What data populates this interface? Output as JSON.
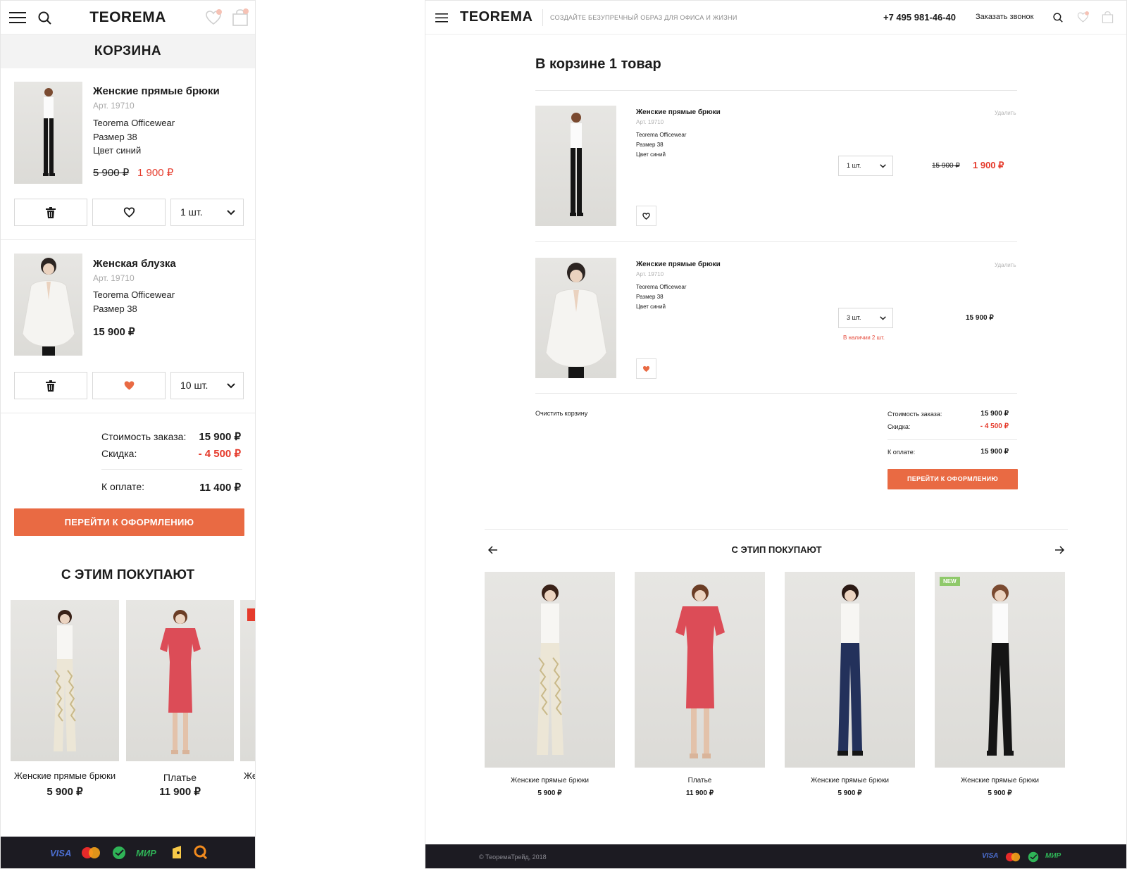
{
  "mobile": {
    "header": {
      "logo": "TEOREMA"
    },
    "title": "КОРЗИНА",
    "items": [
      {
        "name": "Женские прямые брюки",
        "art": "Арт. 19710",
        "brand": "Teorema Officewear",
        "size": "Размер 38",
        "color": "Цвет синий",
        "old_price": "5 900 ₽",
        "price": "1 900 ₽",
        "qty": "1 шт."
      },
      {
        "name": "Женская блузка",
        "art": "Арт. 19710",
        "brand": "Teorema Officewear",
        "size": "Размер 38",
        "price": "15 900 ₽",
        "qty": "10 шт."
      }
    ],
    "summary": {
      "cost_label": "Стоимость заказа:",
      "cost_value": "15 900 ₽",
      "discount_label": "Скидка:",
      "discount_value": "- 4 500 ₽",
      "total_label": "К оплате:",
      "total_value": "11 400 ₽"
    },
    "checkout_label": "ПЕРЕЙТИ К ОФОРМЛЕНИЮ",
    "reco_title": "С ЭТИМ ПОКУПАЮТ",
    "reco": [
      {
        "name": "Женские прямые брюки",
        "price": "5 900 ₽"
      },
      {
        "name": "Платье",
        "price": "11 900 ₽"
      },
      {
        "name": "Же",
        "price": ""
      }
    ],
    "payments": [
      "VISA",
      "МИР"
    ]
  },
  "desktop": {
    "header": {
      "logo": "TEOREMA",
      "tagline": "СОЗДАЙТЕ БЕЗУПРЕЧНЫЙ ОБРАЗ ДЛЯ ОФИСА И ЖИЗНИ",
      "phone": "+7 495 981-46-40",
      "call": "Заказать звонок"
    },
    "title": "В корзине 1 товар",
    "items": [
      {
        "name": "Женские прямые брюки",
        "art": "Арт. 19710",
        "brand": "Teorema Officewear",
        "size": "Размер 38",
        "color": "Цвет синий",
        "remove": "Удалить",
        "qty": "1 шт.",
        "old_price": "15 900 ₽",
        "price": "1 900 ₽"
      },
      {
        "name": "Женские прямые брюки",
        "art": "Арт. 19710",
        "brand": "Teorema Officewear",
        "size": "Размер 38",
        "color": "Цвет синий",
        "remove": "Удалить",
        "qty": "3 шт.",
        "price": "15 900 ₽",
        "stock": "В наличии 2 шт."
      }
    ],
    "clear": "Очистить корзину",
    "summary": {
      "cost_label": "Стоимость заказа:",
      "cost_value": "15 900 ₽",
      "discount_label": "Скидка:",
      "discount_value": "- 4 500 ₽",
      "total_label": "К оплате:",
      "total_value": "15 900 ₽"
    },
    "checkout_label": "ПЕРЕЙТИ К ОФОРМЛЕНИЮ",
    "reco_title": "С ЭТИП ПОКУПАЮТ",
    "reco": [
      {
        "name": "Женские прямые брюки",
        "price": "5 900 ₽"
      },
      {
        "name": "Платье",
        "price": "11 900 ₽"
      },
      {
        "name": "Женские прямые брюки",
        "price": "5 900 ₽"
      },
      {
        "name": "Женские прямые брюки",
        "price": "5 900 ₽",
        "badge": "NEW"
      }
    ],
    "footer": {
      "copyright": "© ТеоремаТрейд, 2018"
    },
    "payments": [
      "VISA",
      "МИР"
    ]
  },
  "colors": {
    "accent": "#e96a43",
    "sale": "#e53b2c",
    "footer": "#1c1b22",
    "badge": "#8fc96a"
  }
}
